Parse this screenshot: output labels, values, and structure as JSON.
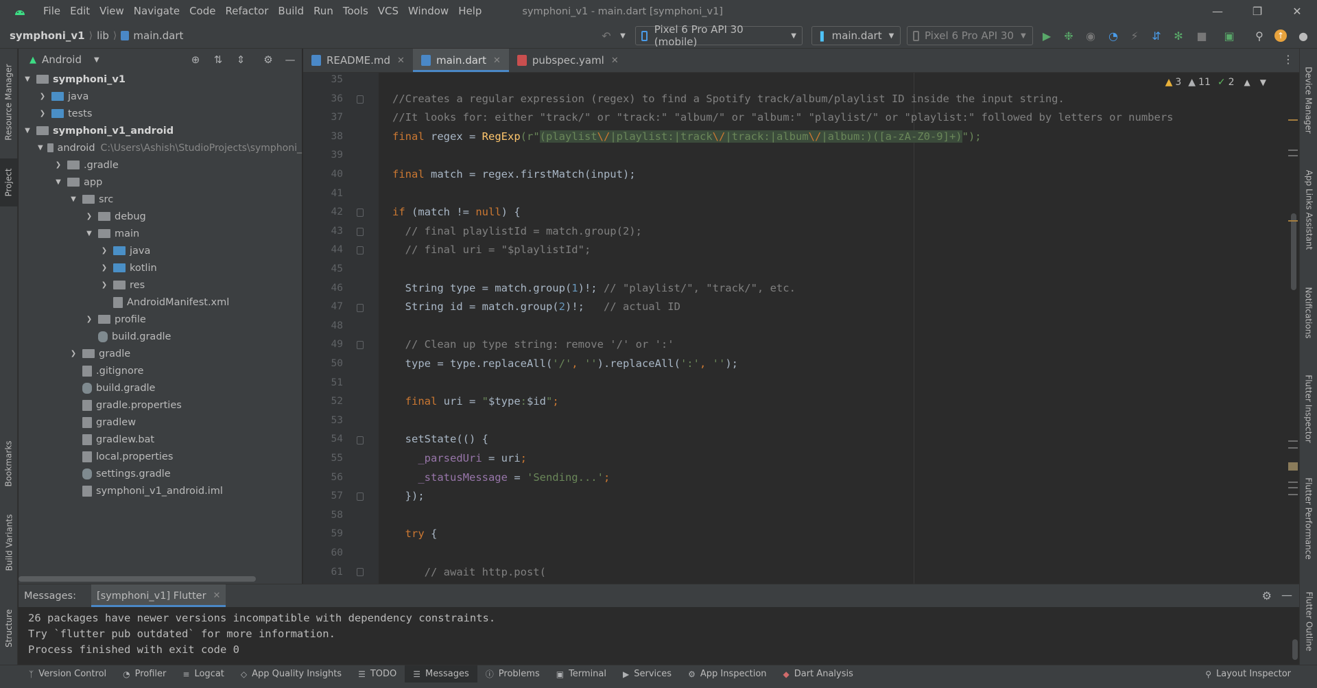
{
  "menu": {
    "items": [
      "File",
      "Edit",
      "View",
      "Navigate",
      "Code",
      "Refactor",
      "Build",
      "Run",
      "Tools",
      "VCS",
      "Window",
      "Help"
    ],
    "window_title": "symphoni_v1 - main.dart [symphoni_v1]"
  },
  "breadcrumb": {
    "project": "symphoni_v1",
    "folder": "lib",
    "file": "main.dart"
  },
  "toolbar": {
    "device_selector": "Pixel 6 Pro API 30 (mobile)",
    "run_config": "main.dart",
    "secondary_device": "Pixel 6 Pro API 30"
  },
  "left_strip": {
    "tabs": [
      "Resource Manager",
      "Project",
      "Bookmarks",
      "Build Variants",
      "Structure"
    ]
  },
  "right_strip": {
    "tabs": [
      "Device Manager",
      "App Links Assistant",
      "Notifications",
      "Flutter Inspector",
      "Flutter Performance",
      "Flutter Outline"
    ]
  },
  "project_panel": {
    "view_mode": "Android",
    "tree": [
      {
        "label": "symphoni_v1",
        "bold": true
      },
      {
        "label": "java"
      },
      {
        "label": "tests"
      },
      {
        "label": "symphoni_v1_android",
        "bold": true
      },
      {
        "label": "android",
        "path": "C:\\Users\\Ashish\\StudioProjects\\symphoni_"
      },
      {
        "label": ".gradle"
      },
      {
        "label": "app"
      },
      {
        "label": "src"
      },
      {
        "label": "debug"
      },
      {
        "label": "main"
      },
      {
        "label": "java"
      },
      {
        "label": "kotlin"
      },
      {
        "label": "res"
      },
      {
        "label": "AndroidManifest.xml"
      },
      {
        "label": "profile"
      },
      {
        "label": "build.gradle"
      },
      {
        "label": "gradle"
      },
      {
        "label": ".gitignore"
      },
      {
        "label": "build.gradle"
      },
      {
        "label": "gradle.properties"
      },
      {
        "label": "gradlew"
      },
      {
        "label": "gradlew.bat"
      },
      {
        "label": "local.properties"
      },
      {
        "label": "settings.gradle"
      },
      {
        "label": "symphoni_v1_android.iml"
      }
    ]
  },
  "editor_tabs": [
    {
      "label": "README.md"
    },
    {
      "label": "main.dart",
      "active": true
    },
    {
      "label": "pubspec.yaml"
    }
  ],
  "inspections": {
    "warnings": "3",
    "weak_warnings": "11",
    "typos": "2"
  },
  "code": {
    "line_numbers": [
      "35",
      "36",
      "37",
      "38",
      "39",
      "40",
      "41",
      "42",
      "43",
      "44",
      "45",
      "46",
      "47",
      "48",
      "49",
      "50",
      "51",
      "52",
      "53",
      "54",
      "55",
      "56",
      "57",
      "58",
      "59",
      "60",
      "61"
    ],
    "l36": "//Creates a regular expression (regex) to find a Spotify track/album/playlist ID inside the input string.",
    "l37": "//It looks for: either \"track/\" or \"track:\" \"album/\" or \"album:\" \"playlist/\" or \"playlist:\" followed by letters or numbers",
    "l38_kw": "final",
    "l38_var": " regex = ",
    "l38_fn": "RegExp",
    "l38_open": "(r\"",
    "l38_rx": "(playlist",
    "l38_e1": "\\/",
    "l38_rx2": "|playlist:|track",
    "l38_e2": "\\/",
    "l38_rx3": "|track:|album",
    "l38_e3": "\\/",
    "l38_rx4": "|album:)([a-zA-Z0-9]+)",
    "l38_close": "\");",
    "l40_kw": "final",
    "l40_rest": " match = regex.firstMatch(input);",
    "l42_kw": "if",
    "l42_a": " (match != ",
    "l42_null": "null",
    "l42_b": ") {",
    "l43": "  // final playlistId = match.group(2);",
    "l44": "  // final uri = \"$playlistId\";",
    "l46_a": "  String type = match.group(",
    "l46_n": "1",
    "l46_b": ")!; ",
    "l46_c": "// \"playlist/\", \"track/\", etc.",
    "l47_a": "  String id = match.group(",
    "l47_n": "2",
    "l47_b": ")!;   ",
    "l47_c": "// actual ID",
    "l49": "  // Clean up type string: remove '/' or ':'",
    "l50_a": "  type = type.replaceAll(",
    "l50_s1": "'/'",
    "l50_b": ", ",
    "l50_s2": "''",
    "l50_c": ").replaceAll(",
    "l50_s3": "':'",
    "l50_d": ", ",
    "l50_s4": "''",
    "l50_e": ");",
    "l52_kw": "  final",
    "l52_a": " uri = ",
    "l52_q1": "\"",
    "l52_i1": "$type",
    "l52_colon": ":",
    "l52_i2": "$id",
    "l52_q2": "\"",
    "l52_semi": ";",
    "l54": "  setState(() {",
    "l55_f": "    _parsedUri",
    "l55_b": " = uri",
    "l55_semi": ";",
    "l56_f": "    _statusMessage",
    "l56_b": " = ",
    "l56_s": "'Sending...'",
    "l56_semi": ";",
    "l57": "  });",
    "l59_kw": "  try",
    "l59_b": " {",
    "l61": "     // await http.post("
  },
  "messages_panel": {
    "label": "Messages:",
    "tab": "[symphoni_v1] Flutter",
    "lines": [
      "26 packages have newer versions incompatible with dependency constraints.",
      "Try `flutter pub outdated` for more information.",
      "Process finished with exit code 0"
    ]
  },
  "bottom_tools": [
    {
      "label": "Version Control",
      "icon": "branch-icon"
    },
    {
      "label": "Profiler",
      "icon": "profiler-icon"
    },
    {
      "label": "Logcat",
      "icon": "logcat-icon"
    },
    {
      "label": "App Quality Insights",
      "icon": "quality-icon"
    },
    {
      "label": "TODO",
      "icon": "todo-icon"
    },
    {
      "label": "Messages",
      "icon": "messages-icon",
      "active": true
    },
    {
      "label": "Problems",
      "icon": "problems-icon"
    },
    {
      "label": "Terminal",
      "icon": "terminal-icon"
    },
    {
      "label": "Services",
      "icon": "services-icon"
    },
    {
      "label": "App Inspection",
      "icon": "inspection-icon"
    },
    {
      "label": "Dart Analysis",
      "icon": "dart-icon"
    },
    {
      "label": "Layout Inspector",
      "icon": "layout-inspector-icon"
    }
  ],
  "colors": {
    "keyword": "#cc7832",
    "comment": "#808080",
    "string": "#6a8759",
    "function": "#ffc66d",
    "number": "#6897bb",
    "field": "#9876aa",
    "accent": "#4a88c7"
  }
}
